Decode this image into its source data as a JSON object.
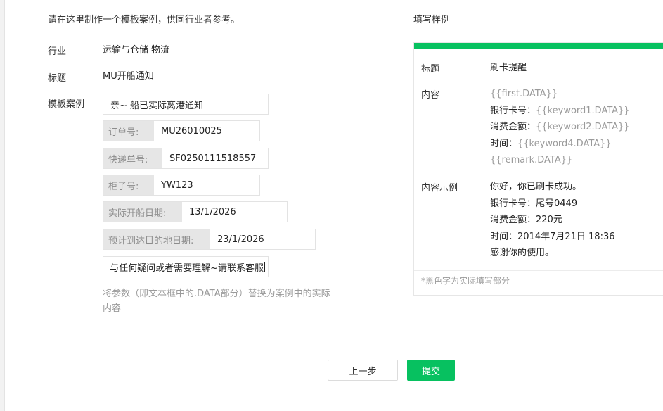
{
  "intro": "请在这里制作一个模板案例，供同行业者参考。",
  "form": {
    "industry_label": "行业",
    "industry_value": "运输与仓储 物流",
    "title_label": "标题",
    "title_value": "MU开船通知",
    "example_label": "模板案例",
    "first_value": "亲~ 船已实际离港通知",
    "fields": [
      {
        "label": "订单号:",
        "value": "MU26010025"
      },
      {
        "label": "快递单号:",
        "value": "SF0250111518557"
      },
      {
        "label": "柜子号:",
        "value": "YW123"
      },
      {
        "label": "实际开船日期:",
        "value": "13/1/2026"
      },
      {
        "label": "预计到达目的地日期:",
        "value": "23/1/2026"
      }
    ],
    "remark_value": "与任何疑问或者需要理解~请联系客服",
    "hint": "将参数（即文本框中的.DATA部分）替换为案例中的实际内容"
  },
  "sample": {
    "heading": "填写样例",
    "title_label": "标题",
    "title_value": "刷卡提醒",
    "content_label": "内容",
    "content_lines": {
      "l1": "{{first.DATA}}",
      "l2_key": "银行卡号：",
      "l2_val": "{{keyword1.DATA}}",
      "l3_key": "消费金额：",
      "l3_val": "{{keyword2.DATA}}",
      "l4_key": "时间：",
      "l4_val": "{{keyword4.DATA}}",
      "l5": "{{remark.DATA}}"
    },
    "example_label": "内容示例",
    "example_lines": [
      "你好，你已刷卡成功。",
      "银行卡号：尾号0449",
      "消费金额：220元",
      "时间：2014年7月21日 18:36",
      "感谢你的使用。"
    ],
    "footnote": "*黑色字为实际填写部分",
    "accent_color": "#07c160"
  },
  "buttons": {
    "prev": "上一步",
    "submit": "提交"
  }
}
